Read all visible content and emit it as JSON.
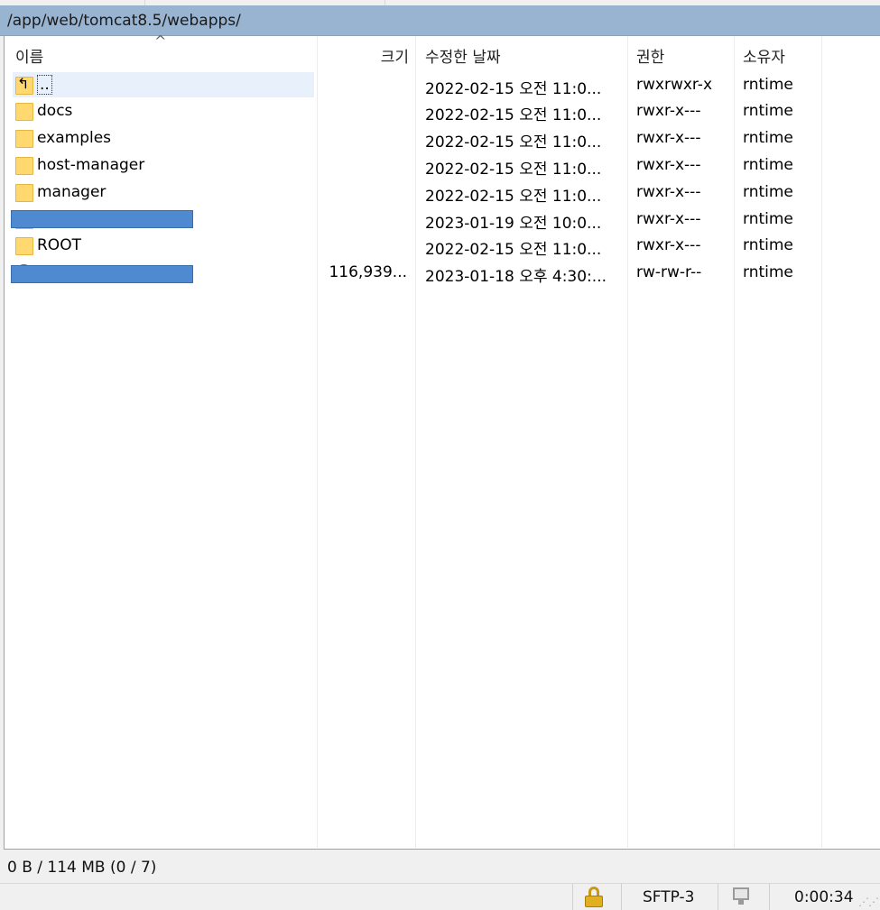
{
  "path": "/app/web/tomcat8.5/webapps/",
  "columns": {
    "name": "이름",
    "size": "크기",
    "modified": "수정한 날짜",
    "perms": "권한",
    "owner": "소유자"
  },
  "rows": [
    {
      "name": "..",
      "size": "",
      "modified": "2022-02-15 오전 11:0...",
      "perms": "rwxrwxr-x",
      "owner": "rntime",
      "icon": "parent-folder-icon"
    },
    {
      "name": "docs",
      "size": "",
      "modified": "2022-02-15 오전 11:0...",
      "perms": "rwxr-x---",
      "owner": "rntime",
      "icon": "folder-icon"
    },
    {
      "name": "examples",
      "size": "",
      "modified": "2022-02-15 오전 11:0...",
      "perms": "rwxr-x---",
      "owner": "rntime",
      "icon": "folder-icon"
    },
    {
      "name": "host-manager",
      "size": "",
      "modified": "2022-02-15 오전 11:0...",
      "perms": "rwxr-x---",
      "owner": "rntime",
      "icon": "folder-icon"
    },
    {
      "name": "manager",
      "size": "",
      "modified": "2022-02-15 오전 11:0...",
      "perms": "rwxr-x---",
      "owner": "rntime",
      "icon": "folder-icon"
    },
    {
      "name": "",
      "size": "",
      "modified": "2023-01-19 오전 10:0...",
      "perms": "rwxr-x---",
      "owner": "rntime",
      "icon": "folder-icon",
      "redacted": true
    },
    {
      "name": "ROOT",
      "size": "",
      "modified": "2022-02-15 오전 11:0...",
      "perms": "rwxr-x---",
      "owner": "rntime",
      "icon": "folder-icon"
    },
    {
      "name": "",
      "size": "116,939...",
      "modified": "2023-01-18 오후 4:30:...",
      "perms": "rw-rw-r--",
      "owner": "rntime",
      "icon": "file-globe-icon",
      "redacted": true
    }
  ],
  "status": {
    "summary": "0 B / 114 MB (0 / 7)",
    "protocol": "SFTP-3",
    "elapsed": "0:00:34"
  },
  "colors": {
    "path_bar": "#99b4d1",
    "redaction": "#4f8ad0",
    "folder": "#ffd970"
  }
}
